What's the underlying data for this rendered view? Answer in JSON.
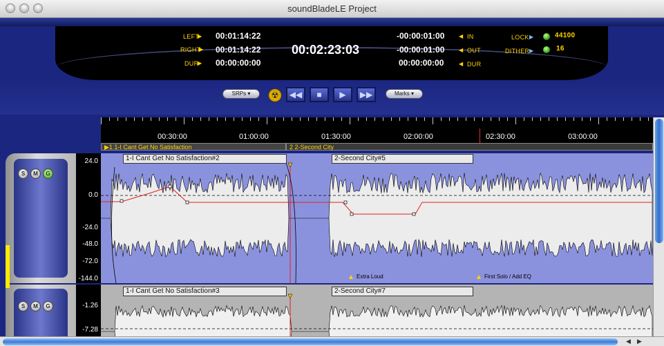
{
  "window": {
    "title": "soundBladeLE Project"
  },
  "transport": {
    "left_label": "LEFT",
    "left_value": "00:01:14:22",
    "right_label": "RIGHT",
    "right_value": "00:01:14:22",
    "dur_label": "DUR",
    "dur_value": "00:00:00:00",
    "main_time": "00:02:23:03",
    "in_label": "IN",
    "in_value": "-00:00:01:00",
    "out_label": "OUT",
    "out_value": "-00:00:01:00",
    "dur2_label": "DUR",
    "dur2_value": "00:00:00:00",
    "lock_label": "LOCK",
    "lock_value": "44100",
    "dither_label": "DITHER",
    "dither_value": "16",
    "srps_label": "SRPs",
    "marks_label": "Marks"
  },
  "ruler": {
    "ticks": [
      "00:30:00",
      "01:00:00",
      "01:30:00",
      "02:00:00",
      "02:30:00",
      "03:00:00"
    ]
  },
  "regions": [
    "1 1-I Cant Get No Satisfaction",
    "2 2-Second City"
  ],
  "tracks": [
    {
      "clips": [
        "1-I Cant Get No Satisfaction#2",
        "2-Second City#5"
      ],
      "scale": [
        "24.0",
        "0.0",
        "-24.0",
        "-48.0",
        "-72.0",
        "-144.0"
      ],
      "markers": [
        "Extra Loud",
        "First Solo / Add EQ"
      ],
      "buttons": [
        "S",
        "M",
        "G"
      ]
    },
    {
      "clips": [
        "1-I Cant Get No Satisfaction#3",
        "2-Second City#7"
      ],
      "scale": [
        "-1.26",
        "-7.28"
      ],
      "buttons": [
        "S",
        "M",
        "G"
      ]
    }
  ],
  "colors": {
    "lcd_yellow": "#ffd400",
    "led_green": "#3fbf1a",
    "track1_bg": "#8b92dd",
    "track2_bg": "#b4b4b4"
  }
}
